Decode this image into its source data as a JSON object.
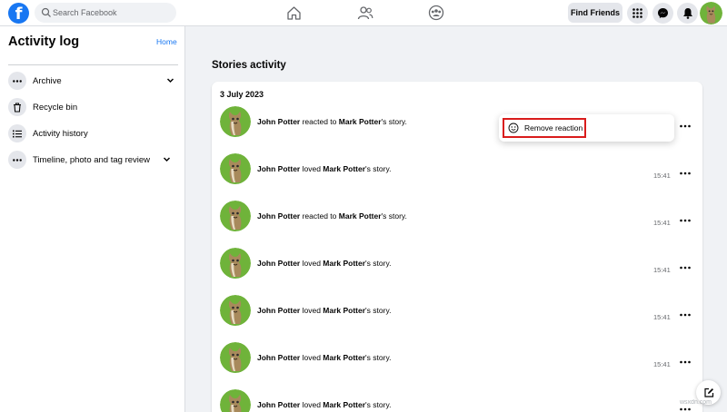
{
  "topbar": {
    "logo": "f",
    "search_placeholder": "Search Facebook",
    "find_friends": "Find Friends",
    "nav_icons": [
      "home-icon",
      "friends-icon",
      "groups-icon"
    ],
    "right_icons": [
      "menu-grid-icon",
      "messenger-icon",
      "bell-icon"
    ]
  },
  "sidebar": {
    "title": "Activity log",
    "home_link": "Home",
    "items": [
      {
        "label": "Archive",
        "icon": "more-dots-icon",
        "expandable": true
      },
      {
        "label": "Recycle bin",
        "icon": "trash-icon",
        "expandable": false
      },
      {
        "label": "Activity history",
        "icon": "list-icon",
        "expandable": false
      },
      {
        "label": "Timeline, photo and tag review",
        "icon": "more-dots-icon",
        "expandable": true
      }
    ]
  },
  "main": {
    "section_title": "Stories activity",
    "date": "3 July 2023",
    "rows": [
      {
        "actor": "John Potter",
        "action": " reacted to ",
        "target": "Mark Potter",
        "suffix": "'s story.",
        "time": ""
      },
      {
        "actor": "John Potter",
        "action": " loved ",
        "target": "Mark Potter",
        "suffix": "'s story.",
        "time": "15:41"
      },
      {
        "actor": "John Potter",
        "action": " reacted to ",
        "target": "Mark Potter",
        "suffix": "'s story.",
        "time": "15:41"
      },
      {
        "actor": "John Potter",
        "action": " loved ",
        "target": "Mark Potter",
        "suffix": "'s story.",
        "time": "15:41"
      },
      {
        "actor": "John Potter",
        "action": " loved ",
        "target": "Mark Potter",
        "suffix": "'s story.",
        "time": "15:41"
      },
      {
        "actor": "John Potter",
        "action": " loved ",
        "target": "Mark Potter",
        "suffix": "'s story.",
        "time": "15:41"
      },
      {
        "actor": "John Potter",
        "action": " loved ",
        "target": "Mark Potter",
        "suffix": "'s story.",
        "time": ""
      }
    ]
  },
  "popup": {
    "item_label": "Remove reaction",
    "icon": "smiley-icon"
  },
  "watermark": "wsxdn.com",
  "colors": {
    "brand": "#1877f2",
    "highlight": "#d91c1c",
    "background": "#f0f2f5"
  }
}
